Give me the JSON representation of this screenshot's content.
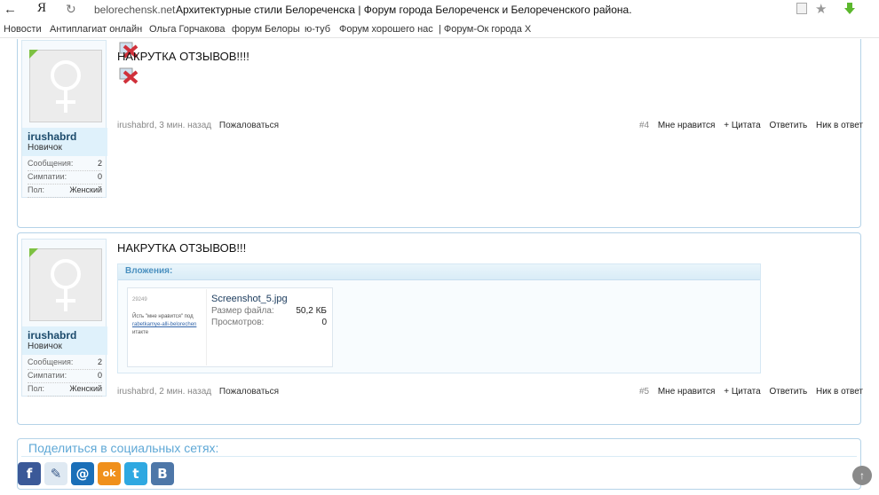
{
  "browser": {
    "back_icon": "arrow-left-icon",
    "yandex_logo": "Я",
    "domain": "belorechensk.net",
    "title": "Архитектурные стили Белореченска | Форум города Белореченск и Белореченского района."
  },
  "bookmarks": [
    "Новости",
    "Антиплагиат онлайн",
    "Ольга Горчакова",
    "форум Белоры",
    "ю-туб",
    "Форум хорошего нас",
    "| Форум-Ок города Х"
  ],
  "posts": [
    {
      "user": {
        "name": "irushabrd",
        "rank": "Новичок"
      },
      "stats": [
        {
          "label": "Сообщения:",
          "value": "2"
        },
        {
          "label": "Симпатии:",
          "value": "0"
        },
        {
          "label": "Пол:",
          "value": "Женский"
        }
      ],
      "message": "НАКРУТКА ОТЗЫВОВ!!!!",
      "meta": {
        "author": "irushabrd",
        "time": "3 мин. назад",
        "complain": "Пожаловаться",
        "number": "#4",
        "like": "Мне нравится",
        "quote": "+ Цитата",
        "reply": "Ответить",
        "nick": "Ник в ответ"
      }
    },
    {
      "user": {
        "name": "irushabrd",
        "rank": "Новичок"
      },
      "stats": [
        {
          "label": "Сообщения:",
          "value": "2"
        },
        {
          "label": "Симпатии:",
          "value": "0"
        },
        {
          "label": "Пол:",
          "value": "Женский"
        }
      ],
      "message": "НАКРУТКА ОТЗЫВОВ!!!",
      "attachments": {
        "header": "Вложения:",
        "file": {
          "name": "Screenshot_5.jpg",
          "size_label": "Размер файла:",
          "size_value": "50,2 КБ",
          "views_label": "Просмотров:",
          "views_value": "0",
          "thumb_number": "29249",
          "thumb_text": "Йсть \"мне нравится\" под",
          "thumb_link": "rabetkamye-alli-belorechen",
          "thumb_text2": "итакте"
        }
      },
      "meta": {
        "author": "irushabrd",
        "time": "2 мин. назад",
        "complain": "Пожаловаться",
        "number": "#5",
        "like": "Мне нравится",
        "quote": "+ Цитата",
        "reply": "Ответить",
        "nick": "Ник в ответ"
      }
    }
  ],
  "share": {
    "title": "Поделиться в социальных сетях:",
    "icons": [
      {
        "name": "facebook-icon",
        "glyph": "f",
        "color": "#3b5998"
      },
      {
        "name": "livejournal-icon",
        "glyph": "✎",
        "color": "#dfe9f2"
      },
      {
        "name": "mailru-icon",
        "glyph": "@",
        "color": "#1a6fb8"
      },
      {
        "name": "odnoklassniki-icon",
        "glyph": "ok",
        "color": "#f0901c"
      },
      {
        "name": "twitter-icon",
        "glyph": "t",
        "color": "#2fa8e1"
      },
      {
        "name": "vkontakte-icon",
        "glyph": "B",
        "color": "#4e77a8"
      }
    ]
  },
  "colors": {
    "accent": "#5fa8d6",
    "border": "#b5d3e8",
    "username": "#1b4a6b"
  }
}
